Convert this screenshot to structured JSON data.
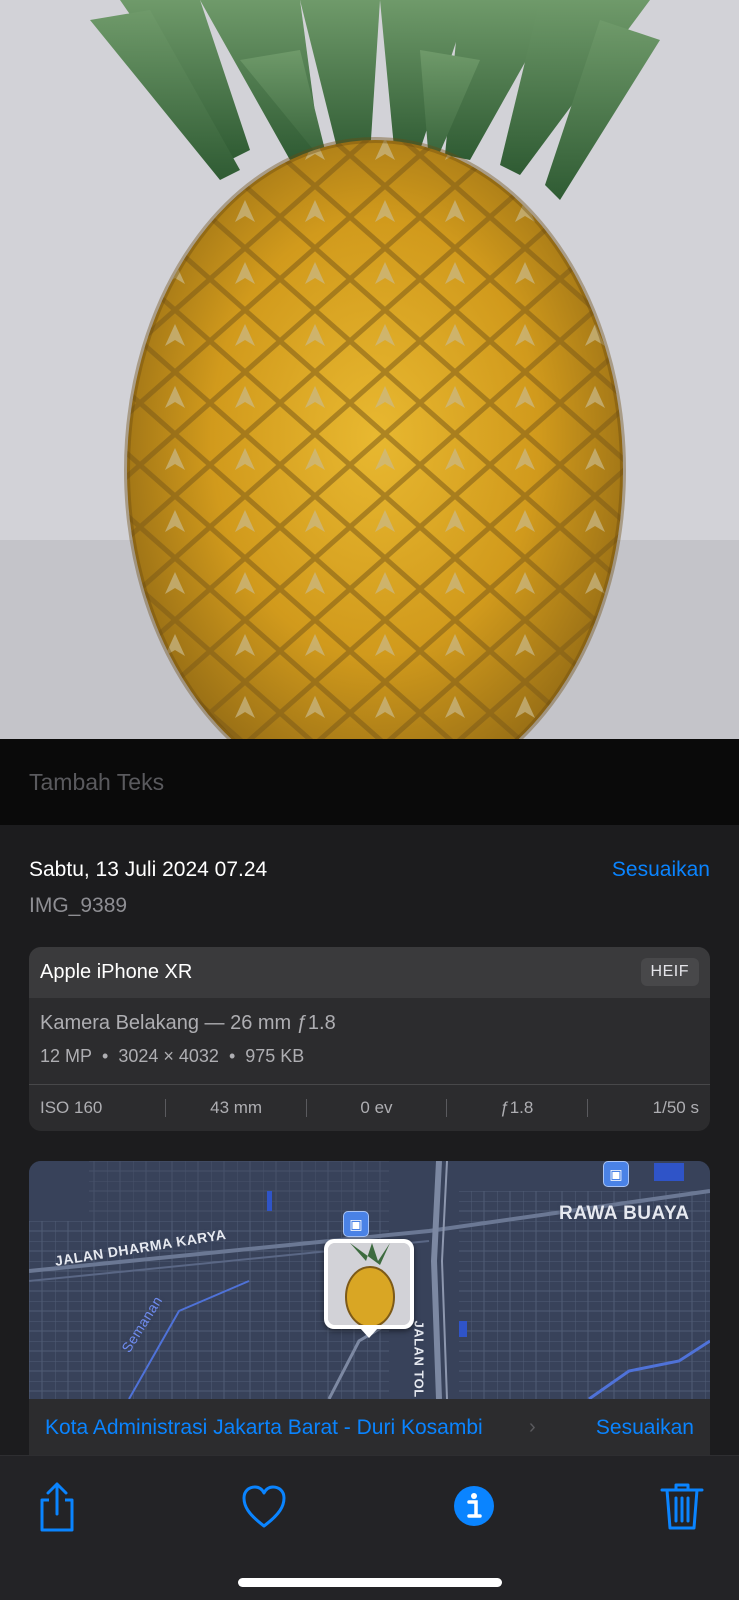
{
  "photo": {
    "subject": "pineapple"
  },
  "caption": {
    "placeholder": "Tambah Teks"
  },
  "info": {
    "date": "Sabtu, 13 Juli 2024 07.24",
    "adjust_label": "Sesuaikan",
    "filename": "IMG_9389"
  },
  "camera": {
    "device": "Apple iPhone XR",
    "format": "HEIF",
    "lens": "Kamera Belakang — 26 mm ƒ1.8",
    "megapixels": "12 MP",
    "resolution": "3024 × 4032",
    "filesize": "975 KB",
    "exif": {
      "iso": "ISO 160",
      "focal": "43 mm",
      "ev": "0 ev",
      "aperture": "ƒ1.8",
      "shutter": "1/50 s"
    }
  },
  "map": {
    "labels": {
      "rawa_buaya": "RAWA BUAYA",
      "jalan_dharma_karya": "JALAN DHARMA KARYA",
      "semanan": "Semanan",
      "jalan_tol": "JALAN TOL LINGKAR LUA"
    },
    "location": "Kota Administrasi Jakarta Barat - Duri Kosambi",
    "adjust_label": "Sesuaikan"
  },
  "toolbar": {
    "share": "share-icon",
    "favorite": "heart-icon",
    "info": "info-icon",
    "delete": "trash-icon"
  },
  "colors": {
    "accent": "#0a84ff",
    "background": "#1c1c1e",
    "card": "#2c2c2e"
  }
}
